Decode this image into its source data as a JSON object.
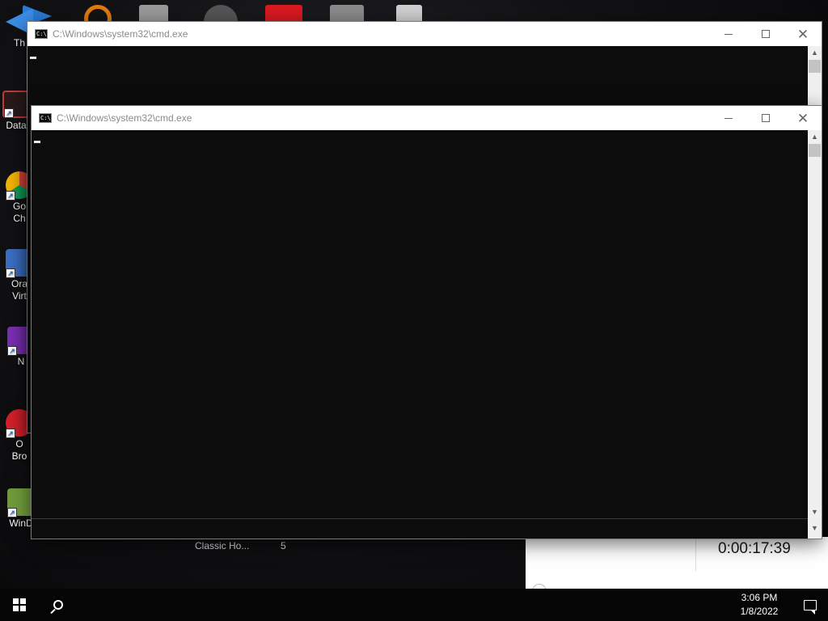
{
  "desktop": {
    "icons": [
      {
        "name": "recycle-bin-icon",
        "label": "Th",
        "color": "#3a8ee6"
      },
      {
        "name": "data-app-icon",
        "label": "Data",
        "color": "#c23b3b"
      },
      {
        "name": "google-chrome-icon",
        "label": "Go\nCh",
        "color": "#2e9e4f"
      },
      {
        "name": "oracle-virtualbox-icon",
        "label": "Ora\nVirt",
        "color": "#3b6fc2"
      },
      {
        "name": "app-n-icon",
        "label": "N",
        "color": "#7b2fb5"
      },
      {
        "name": "opera-browser-icon",
        "label": "O\nBro",
        "color": "#d4202a"
      },
      {
        "name": "windbg-icon",
        "label": "WinD",
        "color": "#6f9a3a"
      }
    ],
    "top_icons": [
      {
        "name": "arrow-app-icon",
        "color": "#2b7bd6"
      },
      {
        "name": "orange-ring-app-icon",
        "color": "#e07a10"
      },
      {
        "name": "media-tool-icon",
        "color": "#9a9a9a"
      },
      {
        "name": "dark-disc-icon",
        "color": "#555555"
      },
      {
        "name": "red-f-app-icon",
        "color": "#d71a20"
      },
      {
        "name": "grey-app-icon",
        "color": "#8a8a8a"
      },
      {
        "name": "document-icon",
        "color": "#cfcfcf"
      }
    ]
  },
  "background_window": {
    "item_label": "Classic Ho...",
    "item_value": "5",
    "timer": "0:00:17:39"
  },
  "cmd_back": {
    "title": "C:\\Windows\\system32\\cmd.exe",
    "icon_text": "C:\\."
  },
  "cmd_front": {
    "title": "C:\\Windows\\system32\\cmd.exe",
    "icon_text": "C:\\."
  },
  "taskbar": {
    "time": "3:06 PM",
    "date": "1/8/2022"
  }
}
